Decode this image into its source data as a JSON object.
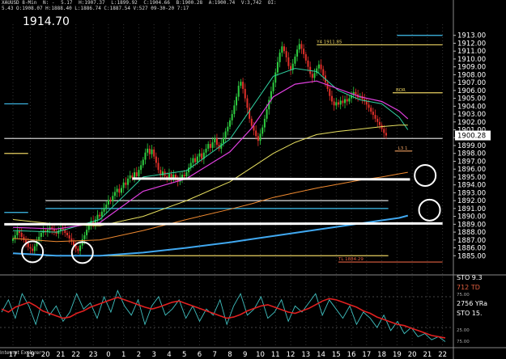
{
  "header": {
    "symbol": "XAUUSD 8-Min",
    "n": "N: -",
    "change": "5.17",
    "high_label": "H:1907.37",
    "low_label": "L:1899.92",
    "close_label": "C:1904.66",
    "bid": "B:1900.28",
    "ask": "A:1900.74",
    "vol_label": "V:3,742",
    "oi": "OI:",
    "line2": "5.43  O:1908.07  H:1888.40  L:1886.74  C:1887.54  V:527  09-30-20 7:17"
  },
  "current_price_display": "1914.70",
  "ie_label": "Internet Explorer",
  "colors": {
    "background": "#000000",
    "bull_candle": "#2ecc40",
    "bear_candle": "#e0302a",
    "ma_fast": "#2fd0a0",
    "ma_magenta": "#e040e0",
    "ma_yellow": "#e8e060",
    "ma_orange": "#f08a30",
    "ma_blue": "#40a8f0",
    "drawn_line": "#ffffff",
    "stoch_red": "#e02020",
    "stoch_teal": "#40c0c0"
  },
  "chart_data": {
    "type": "candlestick",
    "y_range": [
      1884,
      1914
    ],
    "y_ticks": [
      1885,
      1886,
      1887,
      1888,
      1889,
      1890,
      1891,
      1892,
      1893,
      1894,
      1895,
      1896,
      1897,
      1898,
      1899,
      1900,
      1901,
      1902,
      1903,
      1904,
      1905,
      1906,
      1907,
      1908,
      1909,
      1910,
      1911,
      1912,
      1913
    ],
    "x_ticks": [
      "17",
      "19",
      "20",
      "21",
      "22",
      "23",
      "0",
      "1",
      "2",
      "3",
      "4",
      "5",
      "6",
      "7",
      "8",
      "9",
      "10",
      "11",
      "12",
      "13",
      "14",
      "15",
      "16",
      "17",
      "18",
      "19",
      "20",
      "21",
      "22"
    ],
    "x_tick_index": [
      0,
      8,
      15,
      22,
      29,
      37,
      44,
      51,
      58,
      65,
      72,
      79,
      86,
      93,
      100,
      107,
      114,
      121,
      128,
      135,
      142,
      149,
      156,
      163,
      170,
      177,
      184,
      191,
      198
    ],
    "last_price_tag": "1900.28",
    "candles_close": [
      1887.2,
      1887.6,
      1888.1,
      1887.9,
      1887.4,
      1887.0,
      1886.6,
      1886.1,
      1885.9,
      1885.6,
      1886.2,
      1886.9,
      1887.4,
      1887.9,
      1888.2,
      1888.0,
      1888.3,
      1888.6,
      1888.4,
      1888.1,
      1887.8,
      1888.2,
      1888.5,
      1888.3,
      1887.9,
      1887.6,
      1887.2,
      1886.8,
      1886.3,
      1885.9,
      1885.6,
      1886.3,
      1887.1,
      1887.6,
      1888.3,
      1888.9,
      1889.4,
      1889.0,
      1889.6,
      1890.2,
      1890.0,
      1890.6,
      1891.0,
      1891.5,
      1892.1,
      1891.9,
      1892.6,
      1893.1,
      1893.5,
      1893.0,
      1893.6,
      1894.3,
      1894.0,
      1894.8,
      1895.2,
      1894.9,
      1895.6,
      1895.1,
      1895.9,
      1896.5,
      1897.2,
      1898.1,
      1898.6,
      1897.9,
      1898.5,
      1897.6,
      1896.8,
      1895.9,
      1895.2,
      1895.7,
      1895.1,
      1894.9,
      1895.4,
      1894.8,
      1895.3,
      1894.7,
      1894.4,
      1894.9,
      1895.3,
      1895.1,
      1895.6,
      1896.2,
      1896.8,
      1897.4,
      1896.9,
      1897.6,
      1898.0,
      1897.3,
      1898.1,
      1898.6,
      1899.2,
      1898.7,
      1899.4,
      1899.9,
      1899.1,
      1898.6,
      1899.3,
      1900.0,
      1900.8,
      1901.4,
      1902.2,
      1903.0,
      1904.1,
      1905.2,
      1906.6,
      1907.1,
      1906.2,
      1905.0,
      1903.8,
      1902.4,
      1901.5,
      1900.9,
      1900.2,
      1899.6,
      1900.5,
      1901.3,
      1902.4,
      1903.6,
      1904.8,
      1905.9,
      1907.0,
      1908.3,
      1909.6,
      1910.8,
      1911.6,
      1911.0,
      1910.2,
      1909.1,
      1908.6,
      1909.4,
      1910.3,
      1911.2,
      1911.9,
      1911.3,
      1910.6,
      1909.8,
      1909.0,
      1908.1,
      1907.6,
      1908.2,
      1908.8,
      1909.3,
      1908.7,
      1907.9,
      1907.0,
      1906.2,
      1905.3,
      1904.6,
      1904.1,
      1904.5,
      1904.2,
      1904.7,
      1904.4,
      1904.9,
      1904.6,
      1905.0,
      1905.4,
      1905.8,
      1905.5,
      1905.1,
      1905.3,
      1904.9,
      1904.6,
      1904.2,
      1903.8,
      1903.3,
      1902.9,
      1902.4,
      1902.0,
      1901.6,
      1901.1,
      1900.6,
      1900.28
    ],
    "candles_color_hint": "alternating",
    "moving_averages": [
      {
        "points": [
          [
            0,
            1888.2
          ],
          [
            20,
            1888.0
          ],
          [
            40,
            1889.6
          ],
          [
            60,
            1895.0
          ],
          [
            80,
            1895.8
          ],
          [
            100,
            1899.8
          ],
          [
            110,
            1903.8
          ],
          [
            120,
            1907.8
          ],
          [
            130,
            1908.8
          ],
          [
            140,
            1908.4
          ],
          [
            150,
            1906.0
          ],
          [
            160,
            1904.8
          ],
          [
            170,
            1904.3
          ],
          [
            178,
            1902.6
          ],
          [
            182,
            1901.0
          ]
        ]
      },
      {
        "points": [
          [
            0,
            1888.6
          ],
          [
            20,
            1888.4
          ],
          [
            40,
            1889.2
          ],
          [
            60,
            1893.2
          ],
          [
            80,
            1894.8
          ],
          [
            100,
            1898.2
          ],
          [
            110,
            1901.2
          ],
          [
            120,
            1905.2
          ],
          [
            130,
            1906.8
          ],
          [
            140,
            1907.2
          ],
          [
            150,
            1906.2
          ],
          [
            160,
            1905.2
          ],
          [
            170,
            1904.6
          ],
          [
            178,
            1903.4
          ],
          [
            182,
            1902.4
          ]
        ]
      },
      {
        "points": [
          [
            0,
            1889.6
          ],
          [
            20,
            1889.0
          ],
          [
            40,
            1888.8
          ],
          [
            60,
            1890.0
          ],
          [
            80,
            1892.0
          ],
          [
            100,
            1894.4
          ],
          [
            110,
            1896.2
          ],
          [
            120,
            1898.0
          ],
          [
            130,
            1899.4
          ],
          [
            140,
            1900.4
          ],
          [
            150,
            1900.8
          ],
          [
            160,
            1901.1
          ],
          [
            170,
            1901.4
          ],
          [
            178,
            1901.6
          ],
          [
            182,
            1901.6
          ]
        ]
      },
      {
        "points": [
          [
            0,
            1887.2
          ],
          [
            20,
            1886.8
          ],
          [
            40,
            1887.0
          ],
          [
            60,
            1888.2
          ],
          [
            80,
            1889.6
          ],
          [
            100,
            1890.9
          ],
          [
            110,
            1891.6
          ],
          [
            120,
            1892.4
          ],
          [
            130,
            1893.0
          ],
          [
            140,
            1893.6
          ],
          [
            150,
            1894.1
          ],
          [
            160,
            1894.6
          ],
          [
            170,
            1895.0
          ],
          [
            178,
            1895.4
          ],
          [
            182,
            1895.6
          ]
        ]
      },
      {
        "points": [
          [
            0,
            1885.3
          ],
          [
            20,
            1885.0
          ],
          [
            40,
            1885.0
          ],
          [
            60,
            1885.4
          ],
          [
            80,
            1886.0
          ],
          [
            100,
            1886.7
          ],
          [
            110,
            1887.1
          ],
          [
            120,
            1887.5
          ],
          [
            130,
            1887.9
          ],
          [
            140,
            1888.3
          ],
          [
            150,
            1888.7
          ],
          [
            160,
            1889.1
          ],
          [
            170,
            1889.5
          ],
          [
            178,
            1889.8
          ],
          [
            182,
            1890.1
          ]
        ]
      }
    ],
    "horizontal_lines": [
      {
        "value": 1913.0,
        "color": "#40c0f0",
        "from": 177,
        "to": 198
      },
      {
        "value": 1911.8,
        "color": "#e8d060",
        "from": 140,
        "to": 198,
        "label": "Y4 1911.85"
      },
      {
        "value": 1905.7,
        "color": "#e8d060",
        "from": 175,
        "to": 198,
        "label": "BOR"
      },
      {
        "value": 1898.3,
        "color": "#f0a060",
        "from": 176,
        "to": 184,
        "label": "L3 1"
      },
      {
        "value": 1892.0,
        "color": "#e0e0e0",
        "from": 15,
        "to": 173
      },
      {
        "value": 1891.0,
        "color": "#40c0f0",
        "from": 15,
        "to": 173
      },
      {
        "value": 1885.0,
        "color": "#e8d060",
        "from": 15,
        "to": 173
      },
      {
        "value": 1884.2,
        "color": "#e06040",
        "from": 150,
        "to": 198,
        "label": "TL 1884.29"
      },
      {
        "value": 1904.3,
        "color": "#40c0f0",
        "from": -4,
        "to": 7
      },
      {
        "value": 1899.9,
        "color": "#d0d0d0",
        "from": -4,
        "to": 198
      },
      {
        "value": 1898.0,
        "color": "#e8d060",
        "from": -4,
        "to": 7
      },
      {
        "value": 1890.5,
        "color": "#40c0f0",
        "from": -4,
        "to": 7
      }
    ],
    "drawn_trendlines": [
      {
        "from": [
          55,
          1894.8
        ],
        "to": [
          183,
          1894.7
        ]
      },
      {
        "from": [
          -4,
          1889.0
        ],
        "to": [
          198,
          1889.1
        ]
      }
    ],
    "circles": [
      {
        "x": 9,
        "y": 1885.5
      },
      {
        "x": 32,
        "y": 1885.4
      },
      {
        "x": 190,
        "y": 1895.2
      },
      {
        "x": 192,
        "y": 1890.8
      }
    ],
    "stochastic": {
      "label1": "712 TD",
      "label2": "2756 YRa",
      "label3": "STO 9.3",
      "label4": "STO 15.",
      "tick_top": "75.00",
      "tick_bottom": "25.00",
      "tick_bottom2": "75.00",
      "red": [
        55,
        50,
        58,
        62,
        66,
        60,
        52,
        48,
        44,
        40,
        42,
        48,
        52,
        58,
        62,
        66,
        70,
        74,
        70,
        66,
        62,
        58,
        55,
        58,
        62,
        66,
        68,
        64,
        60,
        56,
        52,
        48,
        44,
        40,
        42,
        46,
        52,
        56,
        60,
        62,
        58,
        54,
        50,
        48,
        52,
        56,
        62,
        68,
        72,
        70,
        66,
        62,
        58,
        52,
        48,
        42,
        38,
        34,
        30,
        28,
        24,
        20,
        16,
        12,
        10,
        8
      ],
      "teal": [
        50,
        70,
        40,
        80,
        60,
        30,
        70,
        45,
        60,
        35,
        50,
        80,
        55,
        65,
        40,
        75,
        50,
        85,
        60,
        45,
        70,
        30,
        60,
        75,
        45,
        55,
        70,
        40,
        60,
        35,
        55,
        45,
        70,
        30,
        60,
        80,
        45,
        55,
        75,
        40,
        50,
        70,
        35,
        60,
        50,
        65,
        80,
        45,
        70,
        55,
        40,
        60,
        30,
        50,
        40,
        25,
        45,
        20,
        35,
        15,
        25,
        10,
        15,
        5,
        10,
        2
      ]
    }
  }
}
